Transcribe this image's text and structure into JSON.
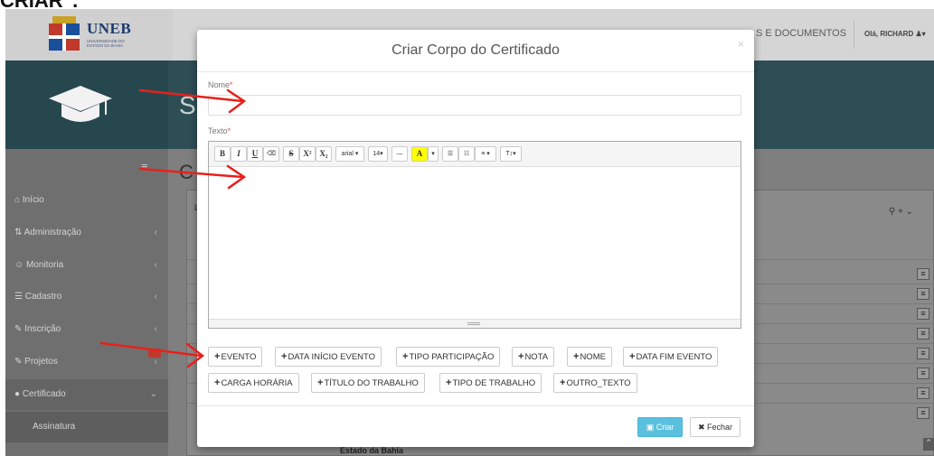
{
  "caption": "CRIAR\".",
  "app": {
    "logo_text": "UNEB",
    "logo_subtext": "UNIVERSIDADE DO ESTADO DA BAHIA",
    "top_nav_docs": "S E DOCUMENTOS",
    "top_nav_user": "Olá, RICHARD",
    "banner_letter": "S",
    "content_letter": "C",
    "panel_letter": "L",
    "sidebar": [
      {
        "label": "Início",
        "icon": "home-icon"
      },
      {
        "label": "Administração",
        "icon": "sitemap-icon"
      },
      {
        "label": "Monitoria",
        "icon": "users-icon"
      },
      {
        "label": "Cadastro",
        "icon": "list-icon"
      },
      {
        "label": "Inscrição",
        "icon": "edit-icon"
      },
      {
        "label": "Projetos",
        "icon": "edit-icon"
      },
      {
        "label": "Certificado",
        "icon": "circle-icon"
      },
      {
        "label": "Assinatura",
        "icon": ""
      }
    ],
    "footer_text": "Estado da Bahia"
  },
  "modal": {
    "title": "Criar Corpo do Certificado",
    "close": "×",
    "nome_label": "Nome",
    "nome_value": "",
    "texto_label": "Texto",
    "required_mark": "*",
    "toolbar": {
      "bold": "B",
      "italic": "I",
      "underline": "U",
      "eraser": "⌫",
      "strike": "S",
      "superscript": "X²",
      "subscript": "X₂",
      "font": "arial ▾",
      "size": "14▾",
      "hr": "—",
      "color": "A",
      "color_caret": "▾",
      "ul": "☰",
      "ol": "☷",
      "align": "≡ ▾",
      "line_height": "T↕▾"
    },
    "tags_row1": [
      "EVENTO",
      "DATA INÍCIO EVENTO",
      "TIPO PARTICIPAÇÃO",
      "NOTA",
      "NOME",
      "DATA FIM EVENTO"
    ],
    "tags_row2": [
      "CARGA HORÁRIA",
      "TÍTULO DO TRABALHO",
      "TIPO DE TRABALHO",
      "OUTRO_TEXTO"
    ],
    "tag_plus": "+",
    "criar_label": "Criar",
    "fechar_label": "Fechar"
  },
  "colors": {
    "arrow": "#e8201a",
    "criar_bg": "#5bc0de",
    "banner": "#2e4e56"
  }
}
